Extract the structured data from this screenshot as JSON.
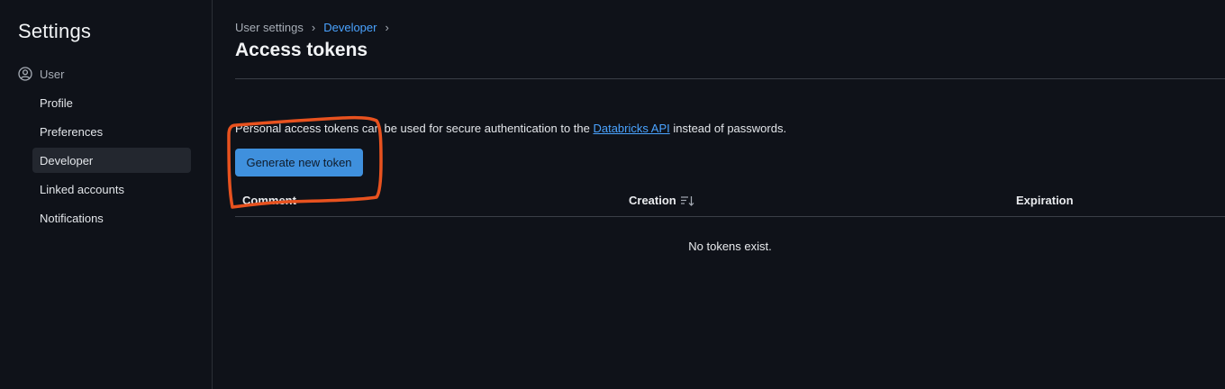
{
  "sidebar": {
    "title": "Settings",
    "section": {
      "label": "User",
      "icon": "user-circle-icon"
    },
    "items": [
      {
        "label": "Profile",
        "active": false
      },
      {
        "label": "Preferences",
        "active": false
      },
      {
        "label": "Developer",
        "active": true
      },
      {
        "label": "Linked accounts",
        "active": false
      },
      {
        "label": "Notifications",
        "active": false
      }
    ]
  },
  "breadcrumb": {
    "root": "User settings",
    "current": "Developer",
    "separator": "›"
  },
  "page": {
    "title": "Access tokens",
    "description_prefix": "Personal access tokens can be used for secure authentication to the ",
    "description_link": "Databricks API",
    "description_suffix": " instead of passwords.",
    "generate_button": "Generate new token"
  },
  "table": {
    "columns": [
      "Comment",
      "Creation",
      "Expiration"
    ],
    "sort_icon": "sort-descending-icon",
    "empty_message": "No tokens exist."
  },
  "colors": {
    "background": "#0f1219",
    "accent": "#4aa3ff",
    "button": "#3f90dd",
    "annotation": "#e8521f"
  }
}
